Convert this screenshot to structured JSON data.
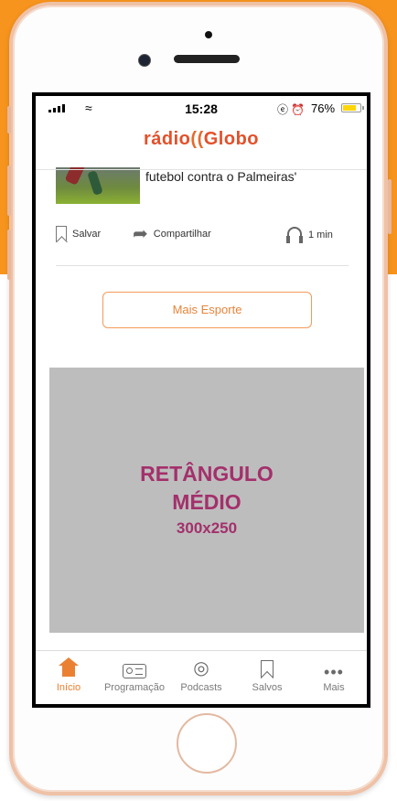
{
  "status_bar": {
    "time": "15:28",
    "battery_percent": "76%",
    "battery_level": 0.76,
    "status_icons": "ⓔ ⏰"
  },
  "header": {
    "logo_text_left": "rádio",
    "logo_wave": "((",
    "logo_text_right": "Globo"
  },
  "article": {
    "headline": "futebol contra o Palmeiras'",
    "save_label": "Salvar",
    "share_label": "Compartilhar",
    "duration": "1 min"
  },
  "more_button": {
    "label": "Mais Esporte"
  },
  "ad": {
    "line1": "RETÂNGULO",
    "line2": "MÉDIO",
    "line3": "300x250"
  },
  "tabbar": {
    "items": [
      {
        "label": "Início",
        "icon": "home-icon",
        "active": true
      },
      {
        "label": "Programação",
        "icon": "radio-icon",
        "active": false
      },
      {
        "label": "Podcasts",
        "icon": "podcast-icon",
        "active": false
      },
      {
        "label": "Salvos",
        "icon": "bookmark-icon",
        "active": false
      },
      {
        "label": "Mais",
        "icon": "more-dots-icon",
        "active": false
      }
    ]
  },
  "colors": {
    "brand_orange": "#f7941d",
    "accent": "#ea8132",
    "ad_text": "#a3306b",
    "ad_background": "#bdbdbd"
  }
}
